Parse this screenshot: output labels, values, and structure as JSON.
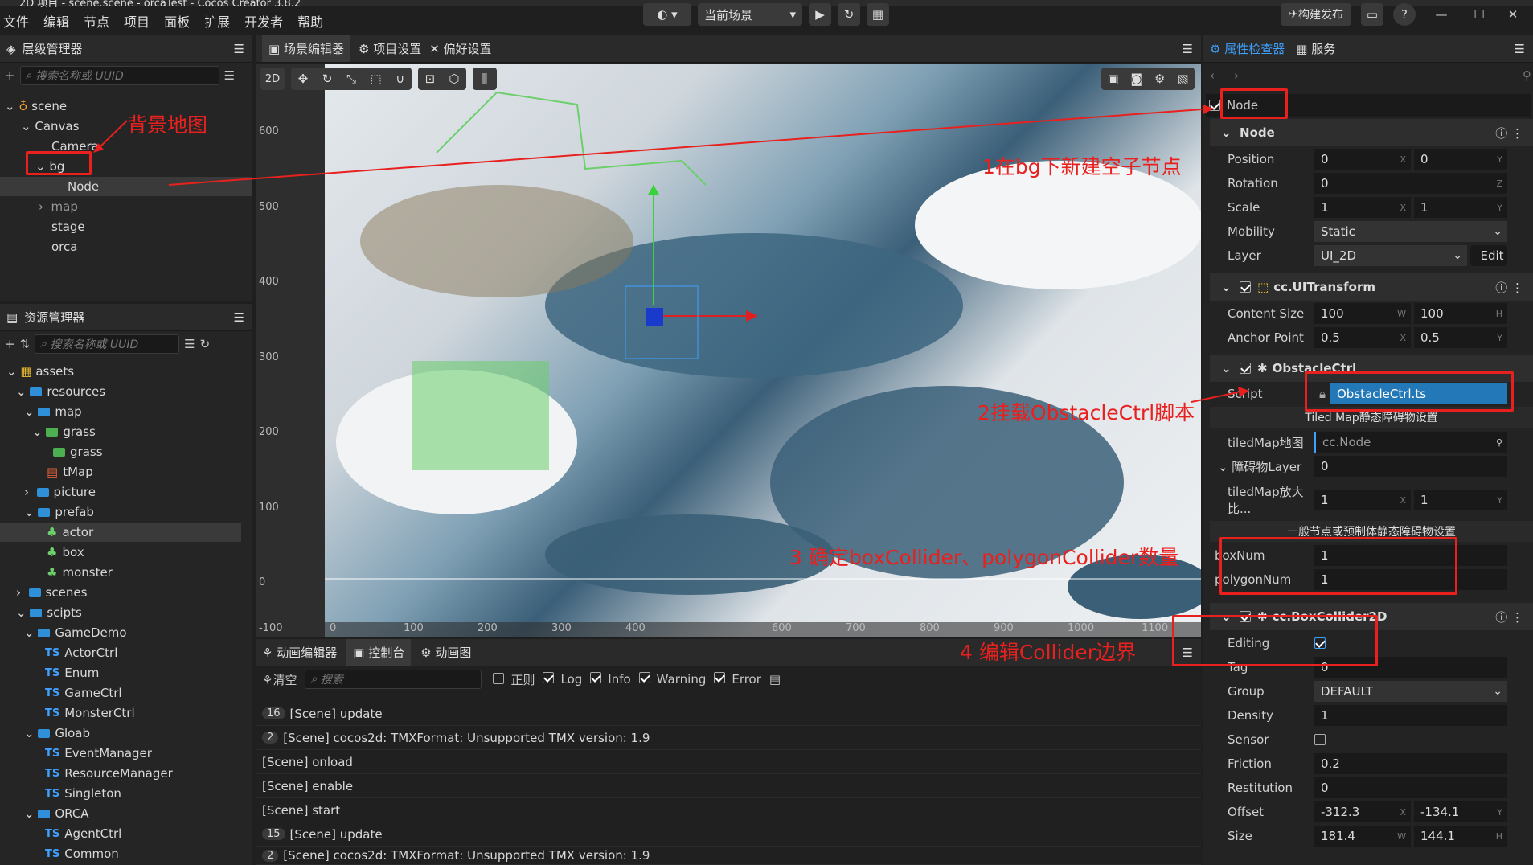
{
  "window": {
    "title": "2D 项目 - scene.scene - orcaTest - Cocos Creator 3.8.2"
  },
  "menu": [
    "文件",
    "编辑",
    "节点",
    "项目",
    "面板",
    "扩展",
    "开发者",
    "帮助"
  ],
  "toolbar": {
    "scene_select": "当前场景",
    "publish": "构建发布"
  },
  "hierarchy": {
    "title": "层级管理器",
    "search_placeholder": "搜索名称或 UUID",
    "items": [
      "scene",
      "Canvas",
      "Camera",
      "bg",
      "Node",
      "map",
      "stage",
      "orca"
    ]
  },
  "assets": {
    "title": "资源管理器",
    "search_placeholder": "搜索名称或 UUID",
    "items": [
      "assets",
      "resources",
      "map",
      "grass",
      "grass",
      "tMap",
      "picture",
      "prefab",
      "actor",
      "box",
      "monster",
      "scenes",
      "scipts",
      "GameDemo",
      "ActorCtrl",
      "Enum",
      "GameCtrl",
      "MonsterCtrl",
      "Gloab",
      "EventManager",
      "ResourceManager",
      "Singleton",
      "ORCA",
      "AgentCtrl",
      "Common"
    ]
  },
  "scene_editor": {
    "tabs": [
      "场景编辑器",
      "项目设置",
      "偏好设置"
    ],
    "mode": "2D",
    "y_ticks": [
      "600",
      "500",
      "400",
      "300",
      "200",
      "100",
      "0",
      "-100"
    ],
    "x_ticks": [
      "0",
      "100",
      "200",
      "300",
      "400",
      "600",
      "700",
      "800",
      "900",
      "1000",
      "1100"
    ]
  },
  "console": {
    "tabs": [
      "动画编辑器",
      "控制台",
      "动画图"
    ],
    "clear": "清空",
    "search_placeholder": "搜索",
    "filters": [
      "正则",
      "Log",
      "Info",
      "Warning",
      "Error"
    ],
    "lines": [
      {
        "n": "16",
        "t": "[Scene] update"
      },
      {
        "n": "2",
        "t": "[Scene] cocos2d: TMXFormat: Unsupported TMX version: 1.9"
      },
      {
        "n": "",
        "t": "[Scene] onload"
      },
      {
        "n": "",
        "t": "[Scene] enable"
      },
      {
        "n": "",
        "t": "[Scene] start"
      },
      {
        "n": "15",
        "t": "[Scene] update"
      },
      {
        "n": "2",
        "t": "[Scene] cocos2d: TMXFormat: Unsupported TMX version: 1.9"
      }
    ]
  },
  "inspector": {
    "tabs": [
      "属性检查器",
      "服务"
    ],
    "node_name": "Node",
    "node_section": "Node",
    "position": [
      "0",
      "0"
    ],
    "rotation": "0",
    "scale": [
      "1",
      "1"
    ],
    "mobility": "Static",
    "layer": "UI_2D",
    "edit": "Edit",
    "uitransform": "cc.UITransform",
    "content_size": [
      "100",
      "100"
    ],
    "anchor": [
      "0.5",
      "0.5"
    ],
    "obstacle": "ObstacleCtrl",
    "script": "ObstacleCtrl.ts",
    "tiled_title": "Tiled Map静态障碍物设置",
    "tiledmap_label": "tiledMap地图",
    "tiledmap_value": "cc.Node",
    "layer_label": "障碍物Layer",
    "layer_value": "0",
    "scale_label": "tiledMap放大比...",
    "scale_value": [
      "1",
      "1"
    ],
    "general_title": "一般节点或预制体静态障碍物设置",
    "boxnum": "1",
    "polygonnum": "1",
    "boxcollider": "cc.BoxCollider2D",
    "editing_label": "Editing",
    "tag": "0",
    "group": "DEFAULT",
    "density": "1",
    "friction": "0.2",
    "restitution": "0",
    "offset": [
      "-312.3",
      "-134.1"
    ],
    "size": [
      "181.4",
      "144.1"
    ],
    "labels": {
      "position": "Position",
      "rotation": "Rotation",
      "scale": "Scale",
      "mobility": "Mobility",
      "layer": "Layer",
      "content_size": "Content Size",
      "anchor": "Anchor Point",
      "script": "Script",
      "boxnum": "boxNum",
      "polygonnum": "polygonNum",
      "tag": "Tag",
      "group": "Group",
      "density": "Density",
      "sensor": "Sensor",
      "friction": "Friction",
      "restitution": "Restitution",
      "offset": "Offset",
      "size": "Size"
    }
  },
  "annotations": {
    "bg_map": "背景地图",
    "step1": "1在bg下新建空子节点",
    "step2": "2挂载ObstacleCtrl脚本",
    "step3": "3 确定boxCollider、polygonCollider数量",
    "step4": "4 编辑Collider边界"
  },
  "colors": {
    "accent": "#3ea1ff",
    "annotation": "#e8211f",
    "collider": "#6ccf6c"
  }
}
